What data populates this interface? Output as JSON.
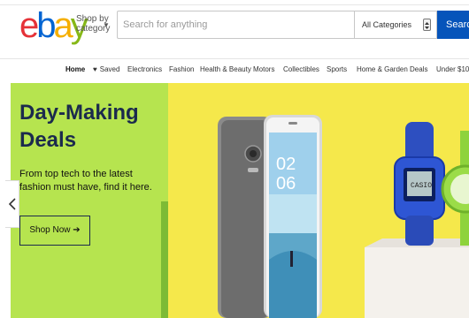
{
  "logo": {
    "e": "e",
    "b": "b",
    "a": "a",
    "y": "y"
  },
  "header": {
    "shop_by_line1": "Shop by",
    "shop_by_line2": "category",
    "search_placeholder": "Search for anything",
    "category_selected": "All Categories",
    "search_button": "Search"
  },
  "nav": {
    "items": [
      {
        "label": "Home",
        "active": true
      },
      {
        "label": "Saved",
        "icon": "heart-icon"
      },
      {
        "label": "Electronics"
      },
      {
        "label": "Fashion"
      },
      {
        "label": "Health & Beauty"
      },
      {
        "label": "Motors"
      },
      {
        "label": "Collectibles"
      },
      {
        "label": "Sports"
      },
      {
        "label": "Home & Garden"
      },
      {
        "label": "Deals"
      },
      {
        "label": "Under $10"
      }
    ]
  },
  "hero": {
    "title_line1": "Day-Making",
    "title_line2": "Deals",
    "subtitle": "From top tech to the latest fashion must have, find it here.",
    "cta": "Shop Now",
    "cta_icon": "arrow-right-icon",
    "phone_time": "02",
    "phone_date": "06",
    "watch_label": "CASIO"
  },
  "colors": {
    "ebay_red": "#e53238",
    "ebay_blue": "#0064d2",
    "ebay_yellow": "#f5af02",
    "ebay_green": "#86b817",
    "search_button": "#0654ba",
    "hero_bg": "#f5e84b",
    "hero_panel": "#b6e44f",
    "hero_title": "#1b2a4d"
  }
}
